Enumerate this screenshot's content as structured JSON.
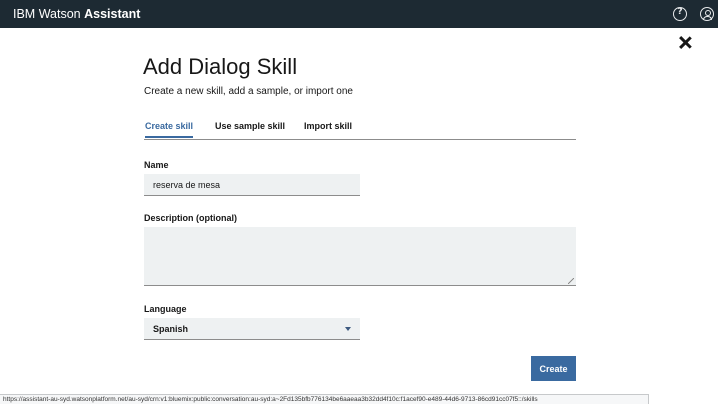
{
  "header": {
    "brand_prefix": "IBM Watson",
    "brand_product": "Assistant",
    "icons": [
      "help-icon",
      "user-icon"
    ]
  },
  "dialog": {
    "close_icon": "close-icon",
    "title": "Add Dialog Skill",
    "subtitle": "Create a new skill, add a sample, or import one",
    "tabs": [
      {
        "label": "Create skill",
        "active": true
      },
      {
        "label": "Use sample skill",
        "active": false
      },
      {
        "label": "Import skill",
        "active": false
      }
    ],
    "form": {
      "name_label": "Name",
      "name_value": "reserva de mesa",
      "description_label": "Description (optional)",
      "description_value": "",
      "language_label": "Language",
      "language_value": "Spanish"
    },
    "create_label": "Create"
  },
  "status_bar": {
    "url": "https://assistant-au-syd.watsonplatform.net/au-syd/crn:v1:bluemix:public:conversation:au-syd:a~2Fd135bfb776134be6aaeaa3b32dd4f10c:f1acef90-e489-44d6-9713-86cd91cc07f5::/skills"
  },
  "colors": {
    "topbar": "#1d2a33",
    "accent": "#3a6aa0",
    "field_bg": "#eef1f2"
  }
}
